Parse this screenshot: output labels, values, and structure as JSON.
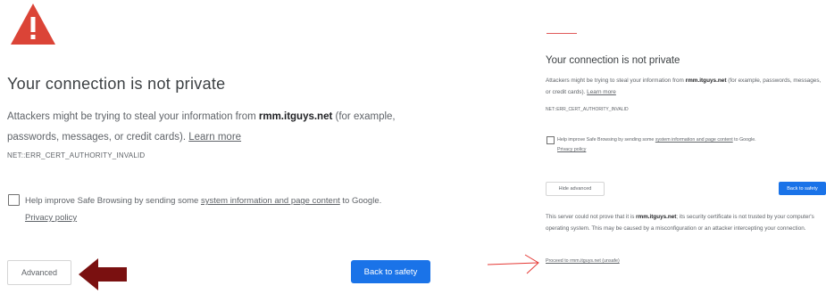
{
  "left": {
    "title": "Your connection is not private",
    "desc_pre": "Attackers might be trying to steal your information from ",
    "desc_domain": "rmm.itguys.net",
    "desc_post": " (for example, passwords, messages, or credit cards). ",
    "learn_more": "Learn more",
    "error_code": "NET::ERR_CERT_AUTHORITY_INVALID",
    "checkbox_pre": "Help improve Safe Browsing by sending some ",
    "checkbox_link": "system information and page content",
    "checkbox_post": " to Google.",
    "privacy_policy": "Privacy policy",
    "advanced_label": "Advanced",
    "back_label": "Back to safety"
  },
  "right": {
    "title": "Your connection is not private",
    "desc_pre": "Attackers might be trying to steal your information from ",
    "desc_domain": "rmm.itguys.net",
    "desc_post": " (for example, passwords, messages, or credit cards). ",
    "learn_more": "Learn more",
    "error_code": "NET::ERR_CERT_AUTHORITY_INVALID",
    "checkbox_pre": "Help improve Safe Browsing by sending some ",
    "checkbox_link": "system information and page content",
    "checkbox_post": " to Google.",
    "privacy_policy": "Privacy policy",
    "hide_advanced_label": "Hide advanced",
    "back_label": "Back to safety",
    "server_pre": "This server could not prove that it is ",
    "server_domain": "rmm.itguys.net",
    "server_post": "; its security certificate is not trusted by your computer's operating system. This may be caused by a misconfiguration or an attacker intercepting your connection.",
    "proceed_link": "Proceed to rmm.itguys.net (unsafe)"
  },
  "colors": {
    "accent": "#1a73e8",
    "warning": "#db4437",
    "annotation_arrow": "#7a1010"
  },
  "icons": {
    "warning": "warning-triangle-icon",
    "annotation_big": "arrow-left-icon",
    "annotation_thin": "arrow-right-icon"
  }
}
